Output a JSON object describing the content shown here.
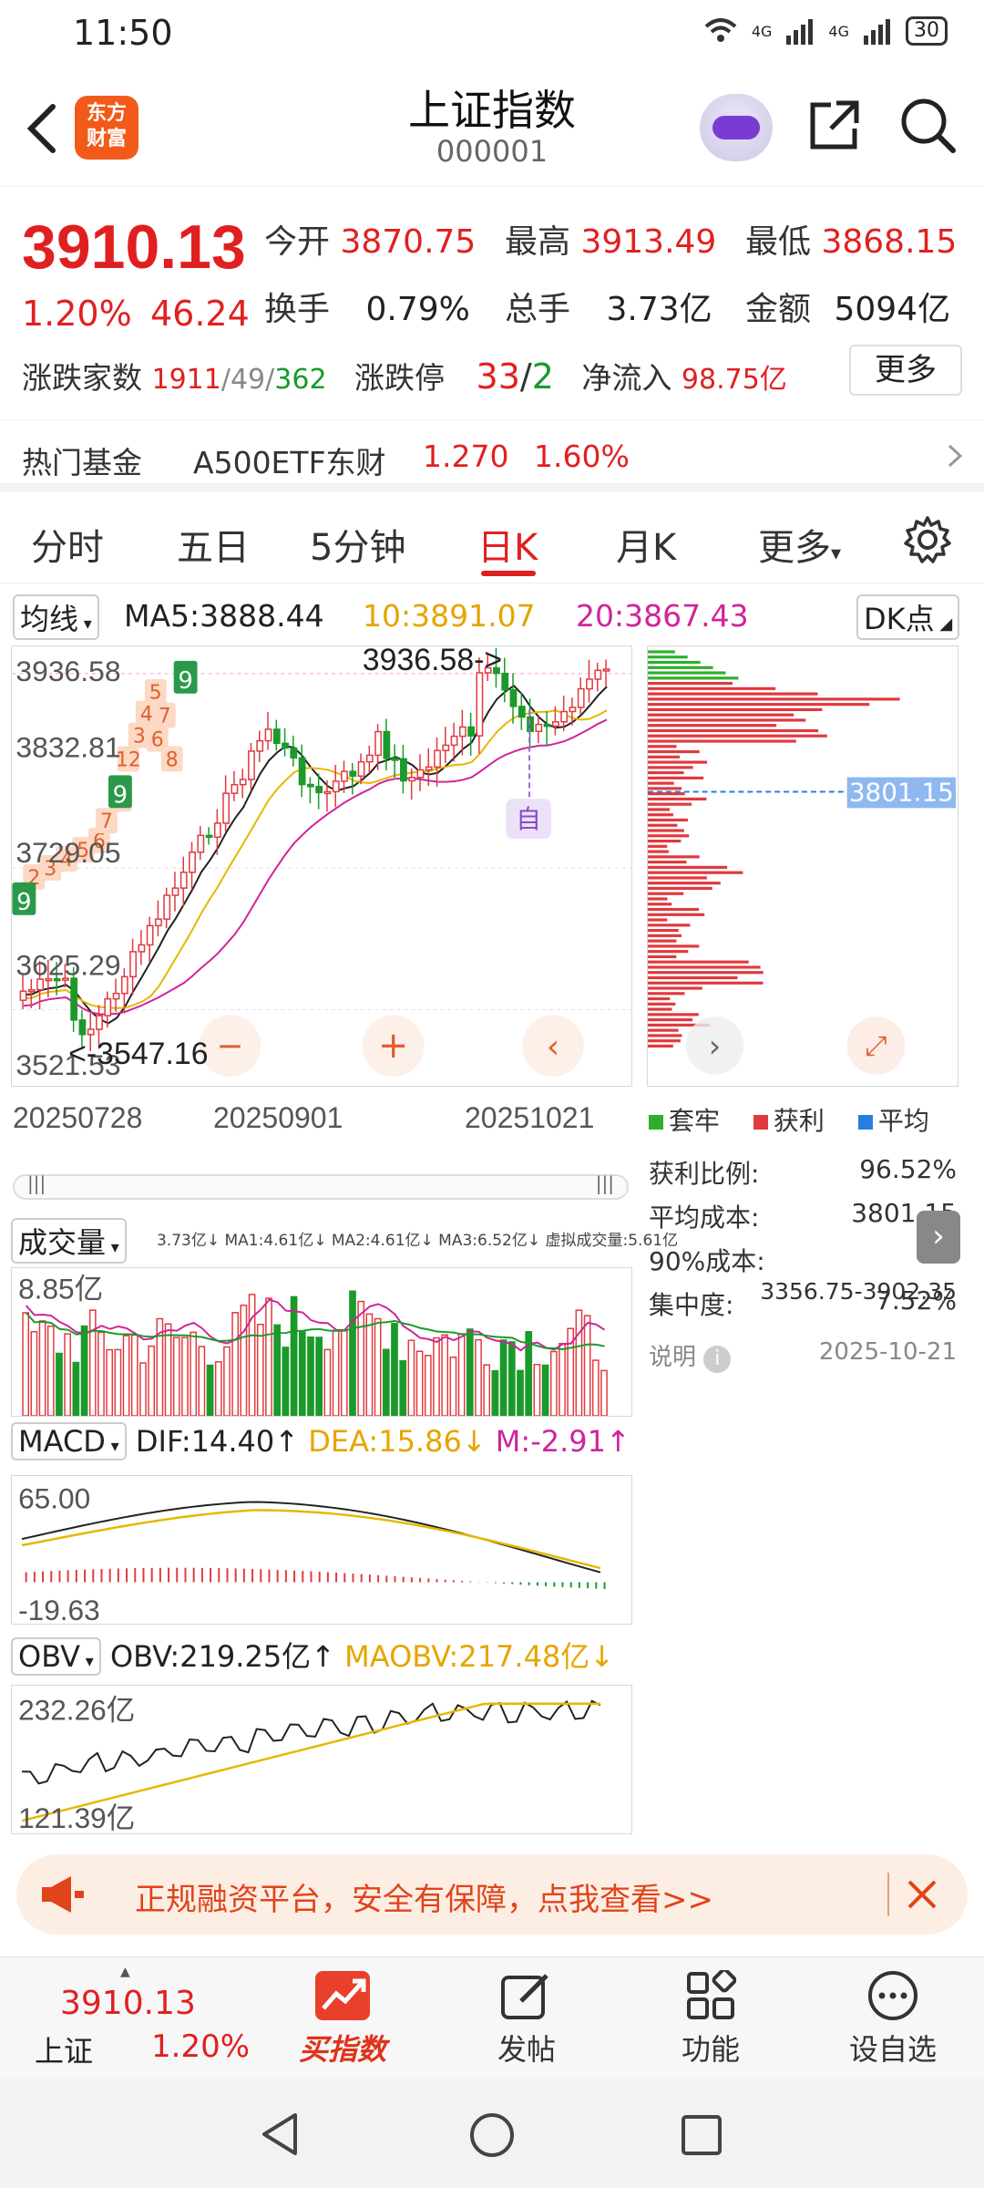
{
  "status": {
    "time": "11:50",
    "net1": "4G",
    "net2": "4G",
    "battery": "30"
  },
  "header": {
    "title": "上证指数",
    "code": "000001",
    "logo_line1": "东方",
    "logo_line2": "财富"
  },
  "quote": {
    "price": "3910.13",
    "change_pct": "1.20%",
    "change": "46.24",
    "open_label": "今开",
    "open": "3870.75",
    "high_label": "最高",
    "high": "3913.49",
    "low_label": "最低",
    "low": "3868.15",
    "turnover_label": "换手",
    "turnover": "0.79%",
    "volume_label": "总手",
    "volume": "3.73亿",
    "amount_label": "金额",
    "amount": "5094亿",
    "adv_label": "涨跌家数",
    "adv_up": "1911",
    "adv_flat": "49",
    "adv_down": "362",
    "limit_label": "涨跌停",
    "limit_up": "33",
    "limit_down": "2",
    "inflow_label": "净流入",
    "inflow": "98.75亿",
    "more_label": "更多"
  },
  "hot_fund": {
    "label": "热门基金",
    "name": "A500ETF东财",
    "price": "1.270",
    "pct": "1.60%"
  },
  "tabs": [
    {
      "label": "分时"
    },
    {
      "label": "五日"
    },
    {
      "label": "5分钟"
    },
    {
      "label": "日K"
    },
    {
      "label": "月K"
    },
    {
      "label": "更多"
    }
  ],
  "ma": {
    "selector": "均线",
    "ma5": "MA5:3888.44",
    "ma10": "10:3891.07",
    "ma20": "20:3867.43",
    "dk": "DK点"
  },
  "kline": {
    "high_label": "3936.58",
    "y2": "3832.81",
    "y3": "3729.05",
    "y4": "3625.29",
    "y5": "3521.53",
    "max_annot": "3936.58->",
    "min_annot": "<-3547.16",
    "self_tag": "自",
    "dates": [
      "20250728",
      "20250901",
      "20251021"
    ],
    "seq_green_top": "9",
    "seq_green_mid": "9",
    "seq_green_left": "9",
    "seq_labels": [
      "5",
      "4",
      "3",
      "12",
      "6",
      "7",
      "8",
      "2",
      "3",
      "4",
      "5",
      "6",
      "7",
      "8"
    ]
  },
  "chip": {
    "avg_cost_tag": "3801.15",
    "legend_trapped": "套牢",
    "legend_profit": "获利",
    "legend_avg": "平均",
    "profit_ratio_label": "获利比例:",
    "profit_ratio": "96.52%",
    "avg_cost_label": "平均成本:",
    "avg_cost": "3801.15",
    "cost90_label": "90%成本:",
    "cost90": "3356.75-3902.35",
    "concentration_label": "集中度:",
    "concentration": "7.52%",
    "note_label": "说明",
    "date": "2025-10-21",
    "colors": {
      "trapped": "#2db02d",
      "profit": "#e0393e",
      "avg": "#2a7de1"
    }
  },
  "volume": {
    "selector": "成交量",
    "summary": "3.73亿↓ MA1:4.61亿↓ MA2:4.61亿↓ MA3:6.52亿↓ 虚拟成交量:5.61亿",
    "top_label": "8.85亿"
  },
  "macd": {
    "selector": "MACD",
    "dif": "DIF:14.40↑",
    "dea": "DEA:15.86↓",
    "m": "M:-2.91↑",
    "top": "65.00",
    "bottom": "-19.63"
  },
  "obv": {
    "selector": "OBV",
    "obv": "OBV:219.25亿↑",
    "maobv": "MAOBV:217.48亿↓",
    "top": "232.26亿",
    "bottom": "121.39亿"
  },
  "ad": {
    "text": "正规融资平台，安全有保障，点我查看>>"
  },
  "bottom_nav": {
    "index_price": "3910.13",
    "index_name": "上证",
    "index_pct": "1.20%",
    "buy_label": "买指数",
    "post_label": "发帖",
    "func_label": "功能",
    "watch_label": "设自选"
  }
}
